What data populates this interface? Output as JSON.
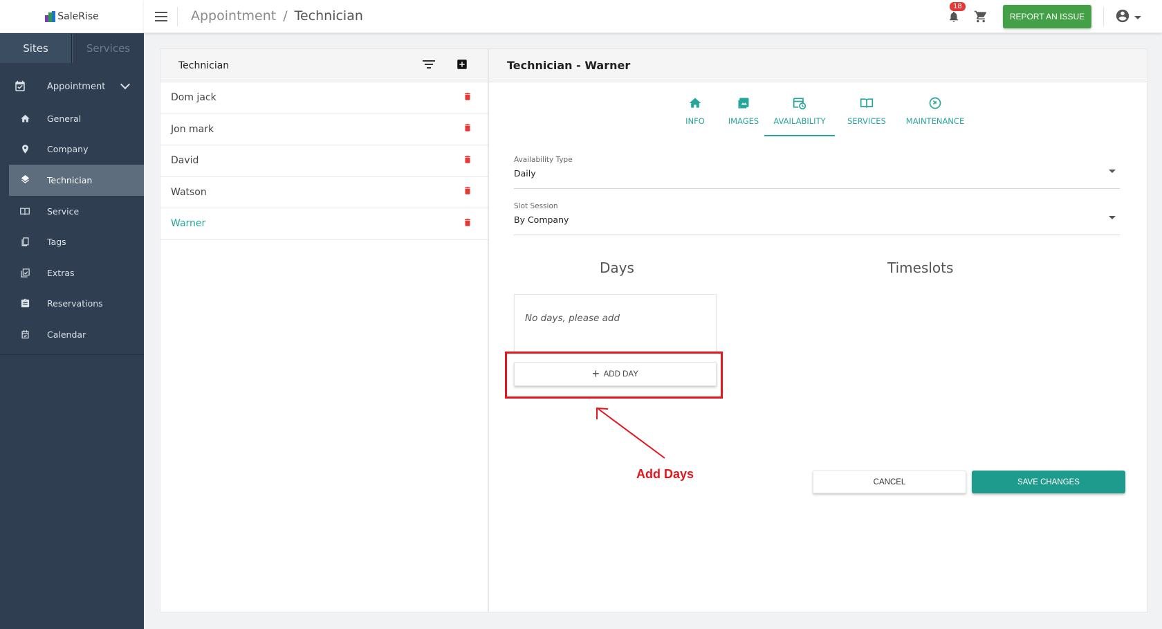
{
  "app": {
    "logo_text": "SaleRise"
  },
  "sidebar": {
    "tabs": [
      {
        "label": "Sites"
      },
      {
        "label": "Services"
      }
    ],
    "group": {
      "label": "Appointment",
      "icon": "calendar-check-icon"
    },
    "items": [
      {
        "label": "General",
        "icon": "home-icon"
      },
      {
        "label": "Company",
        "icon": "location-pin-icon"
      },
      {
        "label": "Technician",
        "icon": "layers-icon"
      },
      {
        "label": "Service",
        "icon": "book-open-icon"
      },
      {
        "label": "Tags",
        "icon": "tag-book-icon"
      },
      {
        "label": "Extras",
        "icon": "extras-icon"
      },
      {
        "label": "Reservations",
        "icon": "clipboard-icon"
      },
      {
        "label": "Calendar",
        "icon": "calendar-icon"
      }
    ],
    "active_item": "Technician"
  },
  "topbar": {
    "breadcrumb": [
      "Appointment",
      "Technician"
    ],
    "breadcrumb_sep": "/",
    "notification_count": "18",
    "report_button": "REPORT AN ISSUE"
  },
  "list_panel": {
    "title": "Technician",
    "rows": [
      {
        "name": "Dom jack"
      },
      {
        "name": "Jon mark"
      },
      {
        "name": "David"
      },
      {
        "name": "Watson"
      },
      {
        "name": "Warner"
      }
    ],
    "selected": "Warner"
  },
  "detail_panel": {
    "title": "Technician - Warner",
    "tabs": [
      {
        "label": "INFO",
        "icon": "home-icon"
      },
      {
        "label": "IMAGES",
        "icon": "image-icon"
      },
      {
        "label": "AVAILABILITY",
        "icon": "calendar-clock-icon"
      },
      {
        "label": "SERVICES",
        "icon": "book-open-icon"
      },
      {
        "label": "MAINTENANCE",
        "icon": "maintenance-icon"
      }
    ],
    "active_tab": "AVAILABILITY",
    "availability_type": {
      "label": "Availability Type",
      "value": "Daily"
    },
    "slot_session": {
      "label": "Slot Session",
      "value": "By Company"
    },
    "days_title": "Days",
    "timeslots_title": "Timeslots",
    "days_empty": "No days, please add",
    "add_day_button": "ADD DAY",
    "annotation": "Add Days",
    "cancel_button": "CANCEL",
    "save_button": "SAVE CHANGES"
  },
  "colors": {
    "sidebar_bg": "#2f3f51",
    "accent_teal": "#26a69a",
    "report_green": "#43a047",
    "delete_red": "#e53935",
    "annotation_red": "#e8141c"
  }
}
